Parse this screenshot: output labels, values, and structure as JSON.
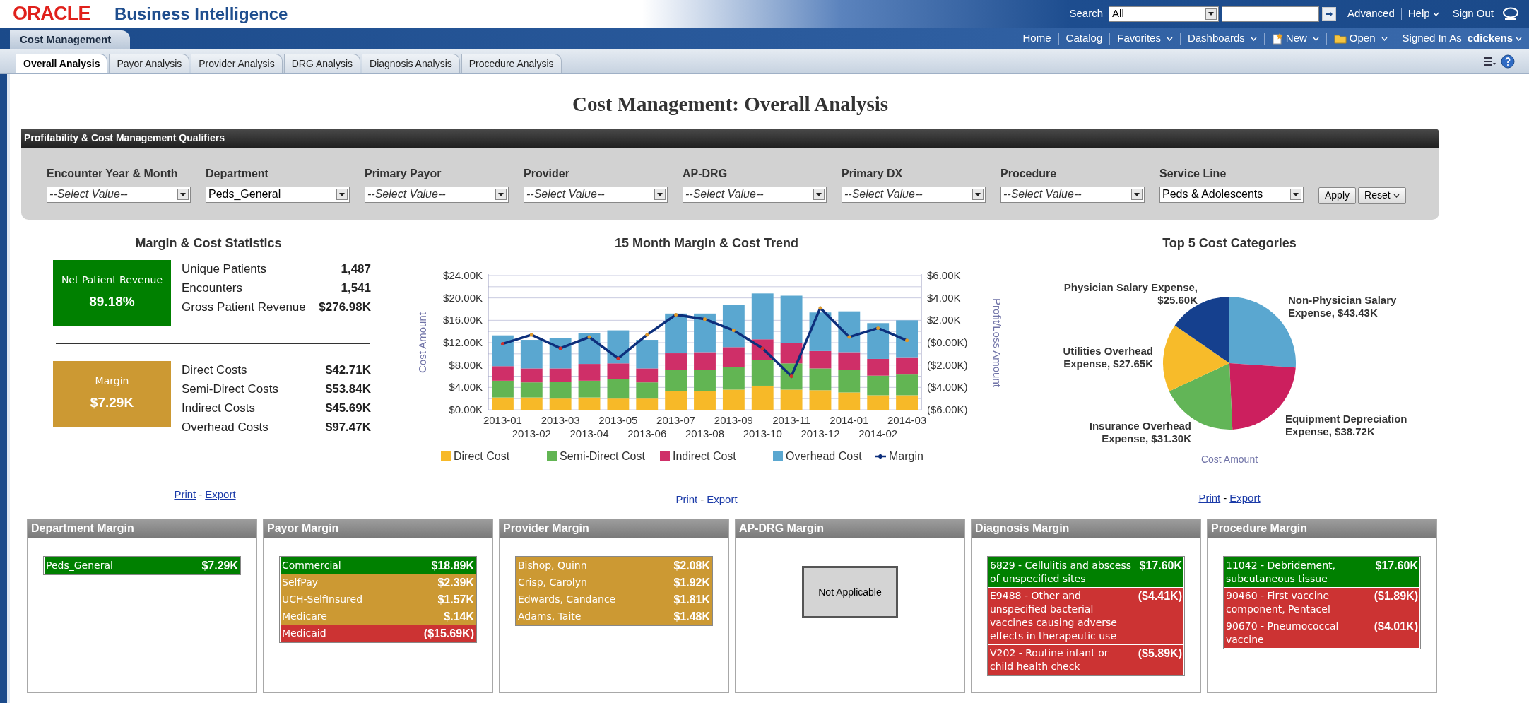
{
  "header": {
    "logo": "ORACLE",
    "product": "Business Intelligence",
    "search_label": "Search",
    "search_scope": "All",
    "links": [
      {
        "label": "Advanced",
        "menu": false
      },
      {
        "label": "Help",
        "menu": true
      },
      {
        "label": "Sign Out",
        "menu": false
      }
    ]
  },
  "dashboard_tab": "Cost Management",
  "nav_links": [
    {
      "label": "Home",
      "kind": "plain",
      "menu": false
    },
    {
      "label": "Catalog",
      "kind": "plain",
      "menu": false
    },
    {
      "label": "Favorites",
      "kind": "plain",
      "menu": true
    },
    {
      "label": "Dashboards",
      "kind": "plain",
      "menu": true
    },
    {
      "label": "New",
      "kind": "new",
      "menu": true
    },
    {
      "label": "Open",
      "kind": "open",
      "menu": true
    },
    {
      "label": "Signed In As",
      "kind": "plain",
      "menu": false
    }
  ],
  "user": "cdickens",
  "page_tabs": [
    {
      "label": "Overall Analysis",
      "selected": true
    },
    {
      "label": "Payor Analysis",
      "selected": false
    },
    {
      "label": "Provider Analysis",
      "selected": false
    },
    {
      "label": "DRG Analysis",
      "selected": false
    },
    {
      "label": "Diagnosis Analysis",
      "selected": false
    },
    {
      "label": "Procedure Analysis",
      "selected": false
    }
  ],
  "title": "Cost Management: Overall Analysis",
  "qualifiers": {
    "title": "Profitability & Cost Management Qualifiers",
    "prompts": [
      {
        "label": "Encounter Year & Month",
        "placeholder": "--Select Value--"
      },
      {
        "label": "Department",
        "value": "Peds_General"
      },
      {
        "label": "Primary Payor",
        "placeholder": "--Select Value--"
      },
      {
        "label": "Provider",
        "placeholder": "--Select Value--"
      },
      {
        "label": "AP-DRG",
        "placeholder": "--Select Value--"
      },
      {
        "label": "Primary DX",
        "placeholder": "--Select Value--"
      },
      {
        "label": "Procedure",
        "placeholder": "--Select Value--"
      },
      {
        "label": "Service Line",
        "value": "Peds & Adolescents"
      }
    ],
    "buttons": [
      {
        "label": "Apply",
        "menu": false
      },
      {
        "label": "Reset",
        "menu": true
      }
    ]
  },
  "stats": {
    "title": "Margin & Cost Statistics",
    "groups": [
      {
        "kpi": {
          "label": "Net Patient Revenue",
          "value": "89.18%",
          "color": "#008000"
        },
        "rows": [
          {
            "label": "Unique Patients",
            "value": "1,487"
          },
          {
            "label": "Encounters",
            "value": "1,541"
          },
          {
            "label": "Gross Patient Revenue",
            "value": "$276.98K"
          }
        ]
      },
      {
        "kpi": {
          "label": "Margin",
          "value": "$7.29K",
          "color": "#cc9933"
        },
        "rows": [
          {
            "label": "Direct Costs",
            "value": "$42.71K"
          },
          {
            "label": "Semi-Direct Costs",
            "value": "$53.84K"
          },
          {
            "label": "Indirect Costs",
            "value": "$45.69K"
          },
          {
            "label": "Overhead Costs",
            "value": "$97.47K"
          }
        ]
      }
    ],
    "links": {
      "print": "Print",
      "separator": "-",
      "export": "Export"
    }
  },
  "trend": {
    "title": "15 Month Margin & Cost Trend",
    "chart_data": {
      "type": "bar",
      "stacked": true,
      "grid": true,
      "legend": true,
      "ylabel": "Cost Amount",
      "y2label": "Profit/Loss Amount",
      "categories": [
        "2013-01",
        "2013-02",
        "2013-03",
        "2013-04",
        "2013-05",
        "2013-06",
        "2013-07",
        "2013-08",
        "2013-09",
        "2013-10",
        "2013-11",
        "2013-12",
        "2014-01",
        "2014-02",
        "2014-03"
      ],
      "ylim": [
        0,
        24000
      ],
      "y2lim": [
        -6000,
        6000
      ],
      "yticks": [
        {
          "value": 0,
          "label": "$0.00K"
        },
        {
          "value": 4000,
          "label": "$4.00K"
        },
        {
          "value": 8000,
          "label": "$8.00K"
        },
        {
          "value": 12000,
          "label": "$12.00K"
        },
        {
          "value": 16000,
          "label": "$16.00K"
        },
        {
          "value": 20000,
          "label": "$20.00K"
        },
        {
          "value": 24000,
          "label": "$24.00K"
        }
      ],
      "y2ticks": [
        {
          "value": -6000,
          "label": "($6.00K)"
        },
        {
          "value": -4000,
          "label": "($4.00K)"
        },
        {
          "value": -2000,
          "label": "($2.00K)"
        },
        {
          "value": 0,
          "label": "($0.00K)"
        },
        {
          "value": 2000,
          "label": "$2.00K"
        },
        {
          "value": 4000,
          "label": "$4.00K"
        },
        {
          "value": 6000,
          "label": "$6.00K"
        }
      ],
      "series": [
        {
          "name": "Direct Cost",
          "color": "#f7b928",
          "values": [
            2200,
            2200,
            2000,
            2200,
            2000,
            2000,
            3300,
            3300,
            3600,
            4300,
            3600,
            3500,
            3100,
            2600,
            2600
          ]
        },
        {
          "name": "Semi-Direct Cost",
          "color": "#62b553",
          "values": [
            3000,
            2700,
            3000,
            3000,
            3500,
            2900,
            3800,
            3800,
            4100,
            4600,
            4700,
            3900,
            4000,
            3500,
            3700
          ]
        },
        {
          "name": "Indirect Cost",
          "color": "#cf2f68",
          "values": [
            2600,
            2500,
            2400,
            3000,
            2800,
            2500,
            3000,
            3200,
            3500,
            3700,
            3700,
            3100,
            3200,
            3000,
            3100
          ]
        },
        {
          "name": "Overhead Cost",
          "color": "#5aa7d0",
          "values": [
            5500,
            5100,
            5400,
            5500,
            5900,
            5100,
            7100,
            6900,
            7500,
            8200,
            8400,
            6900,
            7300,
            6400,
            6600
          ]
        },
        {
          "name": "Margin",
          "color": "#0d2f7c",
          "type": "line",
          "axis": "y2",
          "values": [
            -100,
            700,
            -500,
            500,
            -1400,
            700,
            2500,
            2100,
            1100,
            -500,
            -3000,
            3100,
            500,
            1300,
            200
          ]
        }
      ]
    },
    "links": {
      "print": "Print",
      "separator": "-",
      "export": "Export"
    }
  },
  "pie": {
    "title": "Top 5 Cost Categories",
    "chart_data": {
      "type": "pie",
      "xlabel": "Cost Amount",
      "categories": [
        "Non-Physician Salary Expense, $43.43K",
        "Equipment Depreciation Expense, $38.72K",
        "Insurance Overhead Expense, $31.30K",
        "Utilities Overhead Expense, $27.65K",
        "Physician Salary Expense, $25.60K"
      ],
      "values": [
        43.43,
        38.72,
        31.3,
        27.65,
        25.6
      ],
      "colors": [
        "#5aa7d0",
        "#cc1f5e",
        "#62b557",
        "#f7bb2a",
        "#15408e"
      ]
    },
    "links": {
      "print": "Print",
      "separator": "-",
      "export": "Export"
    }
  },
  "panels": [
    {
      "title": "Department Margin",
      "kind": "list",
      "rows": [
        {
          "label": "Peds_General",
          "value": "$7.29K",
          "color": "#008000"
        }
      ]
    },
    {
      "title": "Payor Margin",
      "kind": "list",
      "rows": [
        {
          "label": "Commercial",
          "value": "$18.89K",
          "color": "#008000"
        },
        {
          "label": "SelfPay",
          "value": "$2.39K",
          "color": "#cc9933"
        },
        {
          "label": "UCH-SelfInsured",
          "value": "$1.57K",
          "color": "#cc9933"
        },
        {
          "label": "Medicare",
          "value": "$.14K",
          "color": "#cc9933"
        },
        {
          "label": "Medicaid",
          "value": "($15.69K)",
          "color": "#cc3333"
        }
      ]
    },
    {
      "title": "Provider Margin",
      "kind": "list",
      "rows": [
        {
          "label": "Bishop, Quinn",
          "value": "$2.08K",
          "color": "#cc9933"
        },
        {
          "label": "Crisp, Carolyn",
          "value": "$1.92K",
          "color": "#cc9933"
        },
        {
          "label": "Edwards, Candance",
          "value": "$1.81K",
          "color": "#cc9933"
        },
        {
          "label": "Adams, Taite",
          "value": "$1.48K",
          "color": "#cc9933"
        }
      ]
    },
    {
      "title": "AP-DRG Margin",
      "kind": "message",
      "message": "Not Applicable"
    },
    {
      "title": "Diagnosis Margin",
      "kind": "list",
      "rows": [
        {
          "label": "6829 - Cellulitis and abscess of unspecified sites",
          "value": "$17.60K",
          "color": "#008000"
        },
        {
          "label": "E9488 - Other and unspecified bacterial vaccines causing adverse effects in therapeutic use",
          "value": "($4.41K)",
          "color": "#cc3333"
        },
        {
          "label": "V202 - Routine infant or child health check",
          "value": "($5.89K)",
          "color": "#cc3333"
        }
      ]
    },
    {
      "title": "Procedure Margin",
      "kind": "list",
      "rows": [
        {
          "label": "11042 - Debridement, subcutaneous tissue",
          "value": "$17.60K",
          "color": "#008000"
        },
        {
          "label": "90460 - First vaccine component, Pentacel",
          "value": "($1.89K)",
          "color": "#cc3333"
        },
        {
          "label": "90670 - Pneumococcal vaccine",
          "value": "($4.01K)",
          "color": "#cc3333"
        }
      ]
    }
  ]
}
